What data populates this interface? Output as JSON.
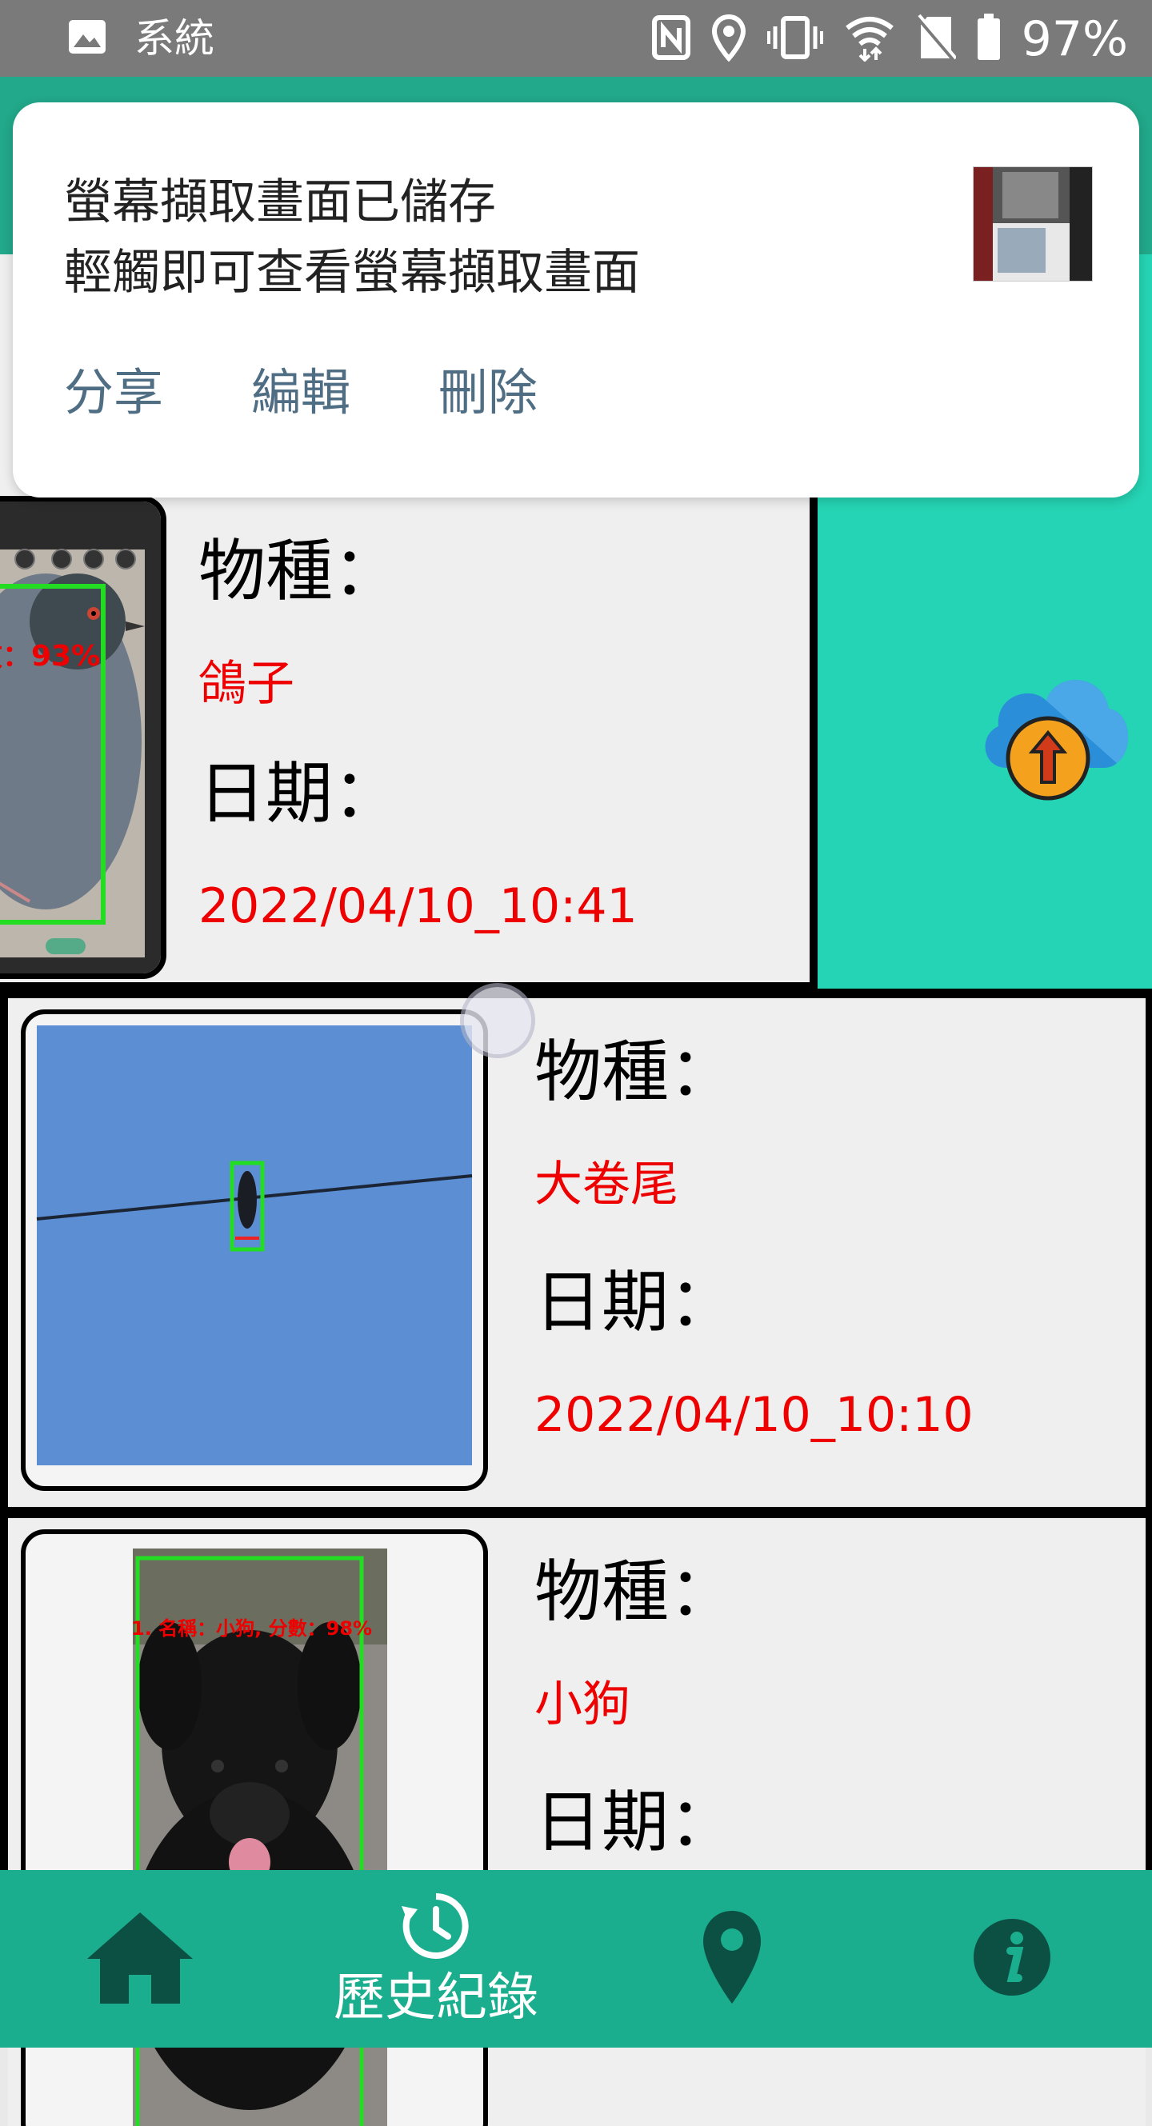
{
  "status_bar": {
    "title": "系統",
    "battery": "97%"
  },
  "notification": {
    "title": "螢幕擷取畫面已儲存",
    "body": "輕觸即可查看螢幕擷取畫面",
    "actions": [
      "分享",
      "編輯",
      "刪除"
    ]
  },
  "records": [
    {
      "species_label": "物種：",
      "species_value": "鴿子",
      "date_label": "日期：",
      "date_value": "2022/04/10_10:41",
      "overlay": "數：93%"
    },
    {
      "species_label": "物種：",
      "species_value": "大卷尾",
      "date_label": "日期：",
      "date_value": "2022/04/10_10:10"
    },
    {
      "species_label": "物種：",
      "species_value": "小狗",
      "date_label": "日期：",
      "overlay": "1. 名稱：小狗, 分數：98%"
    }
  ],
  "bottom_nav": {
    "history_label": "歷史紀錄",
    "icons": [
      "home-icon",
      "history-icon",
      "location-pin-icon",
      "info-icon"
    ]
  },
  "colors": {
    "teal": "#22a88a",
    "upload_panel": "#25d4b4",
    "red": "#ee0000",
    "nav": "#1aae8f"
  }
}
